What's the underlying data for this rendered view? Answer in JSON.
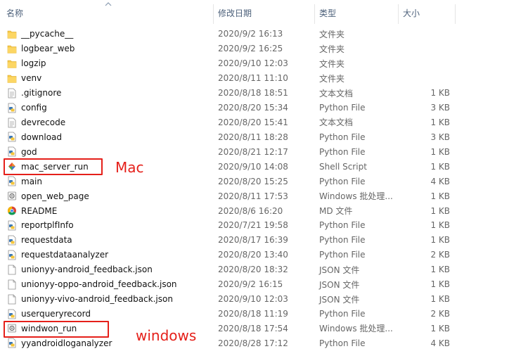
{
  "columns": {
    "name": "名称",
    "date": "修改日期",
    "type": "类型",
    "size": "大小"
  },
  "files": [
    {
      "name": "__pycache__",
      "date": "2020/9/2 16:13",
      "type": "文件夹",
      "size": "",
      "icon": "folder-icon"
    },
    {
      "name": "logbear_web",
      "date": "2020/9/2 16:25",
      "type": "文件夹",
      "size": "",
      "icon": "folder-icon"
    },
    {
      "name": "logzip",
      "date": "2020/9/10 12:03",
      "type": "文件夹",
      "size": "",
      "icon": "folder-icon"
    },
    {
      "name": "venv",
      "date": "2020/8/11 11:10",
      "type": "文件夹",
      "size": "",
      "icon": "folder-icon"
    },
    {
      "name": ".gitignore",
      "date": "2020/8/18 18:51",
      "type": "文本文档",
      "size": "1 KB",
      "icon": "text-file-icon"
    },
    {
      "name": "config",
      "date": "2020/8/20 15:34",
      "type": "Python File",
      "size": "3 KB",
      "icon": "python-file-icon"
    },
    {
      "name": "devrecode",
      "date": "2020/8/20 15:41",
      "type": "文本文档",
      "size": "1 KB",
      "icon": "text-file-icon"
    },
    {
      "name": "download",
      "date": "2020/8/11 18:28",
      "type": "Python File",
      "size": "3 KB",
      "icon": "python-file-icon"
    },
    {
      "name": "god",
      "date": "2020/8/21 12:17",
      "type": "Python File",
      "size": "1 KB",
      "icon": "python-file-icon"
    },
    {
      "name": "mac_server_run",
      "date": "2020/9/10 14:08",
      "type": "Shell Script",
      "size": "1 KB",
      "icon": "shell-script-icon"
    },
    {
      "name": "main",
      "date": "2020/8/20 15:25",
      "type": "Python File",
      "size": "4 KB",
      "icon": "python-file-icon"
    },
    {
      "name": "open_web_page",
      "date": "2020/8/11 17:53",
      "type": "Windows 批处理...",
      "size": "1 KB",
      "icon": "batch-file-icon"
    },
    {
      "name": "README",
      "date": "2020/8/6 16:20",
      "type": "MD 文件",
      "size": "1 KB",
      "icon": "chrome-icon"
    },
    {
      "name": "reportplfInfo",
      "date": "2020/7/21 19:58",
      "type": "Python File",
      "size": "1 KB",
      "icon": "python-file-icon"
    },
    {
      "name": "requestdata",
      "date": "2020/8/17 16:39",
      "type": "Python File",
      "size": "1 KB",
      "icon": "python-file-icon"
    },
    {
      "name": "requestdataanalyzer",
      "date": "2020/8/20 13:40",
      "type": "Python File",
      "size": "2 KB",
      "icon": "python-file-icon"
    },
    {
      "name": "unionyy-android_feedback.json",
      "date": "2020/8/20 18:32",
      "type": "JSON 文件",
      "size": "1 KB",
      "icon": "blank-file-icon"
    },
    {
      "name": "unionyy-oppo-android_feedback.json",
      "date": "2020/9/2 16:15",
      "type": "JSON 文件",
      "size": "1 KB",
      "icon": "blank-file-icon"
    },
    {
      "name": "unionyy-vivo-android_feedback.json",
      "date": "2020/9/10 12:03",
      "type": "JSON 文件",
      "size": "1 KB",
      "icon": "blank-file-icon"
    },
    {
      "name": "userqueryrecord",
      "date": "2020/8/18 11:19",
      "type": "Python File",
      "size": "2 KB",
      "icon": "python-file-icon"
    },
    {
      "name": "windwon_run",
      "date": "2020/8/18 17:54",
      "type": "Windows 批处理...",
      "size": "1 KB",
      "icon": "batch-file-icon"
    },
    {
      "name": "yyandroidloganalyzer",
      "date": "2020/8/28 17:12",
      "type": "Python File",
      "size": "4 KB",
      "icon": "python-file-icon"
    }
  ],
  "annotations": {
    "mac": "Mac",
    "windows": "windows"
  },
  "colors": {
    "annotation": "#e5201a",
    "folder": "#f6c94a",
    "header_text": "#4c607a"
  }
}
